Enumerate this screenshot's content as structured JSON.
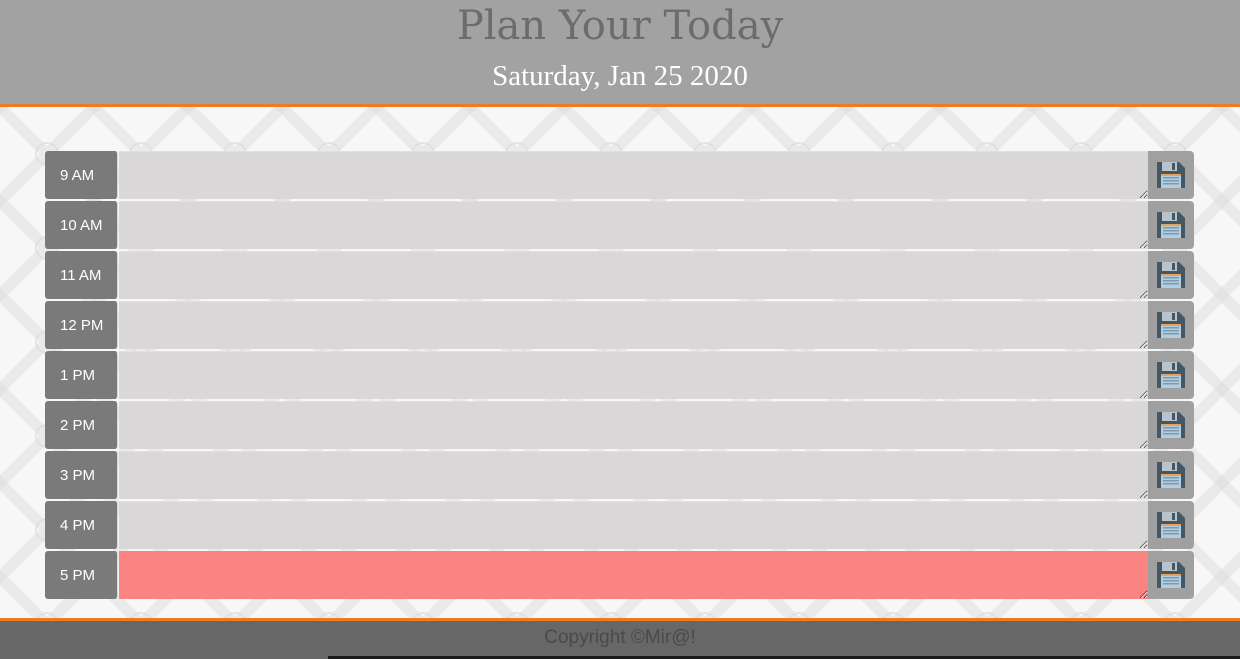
{
  "header": {
    "title": "Plan Your Today",
    "date": "Saturday, Jan 25 2020"
  },
  "schedule": {
    "rows": [
      {
        "hour": "9 AM",
        "text": "",
        "state": "past",
        "save_icon": "floppy-disk-icon"
      },
      {
        "hour": "10 AM",
        "text": "",
        "state": "past",
        "save_icon": "floppy-disk-icon"
      },
      {
        "hour": "11 AM",
        "text": "",
        "state": "past",
        "save_icon": "floppy-disk-icon"
      },
      {
        "hour": "12 PM",
        "text": "",
        "state": "past",
        "save_icon": "floppy-disk-icon"
      },
      {
        "hour": "1 PM",
        "text": "",
        "state": "past",
        "save_icon": "floppy-disk-icon"
      },
      {
        "hour": "2 PM",
        "text": "",
        "state": "past",
        "save_icon": "floppy-disk-icon"
      },
      {
        "hour": "3 PM",
        "text": "",
        "state": "past",
        "save_icon": "floppy-disk-icon"
      },
      {
        "hour": "4 PM",
        "text": "",
        "state": "past",
        "save_icon": "floppy-disk-icon"
      },
      {
        "hour": "5 PM",
        "text": "",
        "state": "present",
        "save_icon": "floppy-disk-icon"
      }
    ]
  },
  "footer": {
    "copyright": "Copyright ©Mir@!"
  },
  "colors": {
    "header_bg": "#a2a2a2",
    "accent": "#f07a22",
    "hour_bg": "#7a7a7a",
    "past_bg": "#d9d7d8",
    "present_bg": "#fa8482",
    "save_bg": "#a0a0a0",
    "footer_bg": "#676767"
  }
}
